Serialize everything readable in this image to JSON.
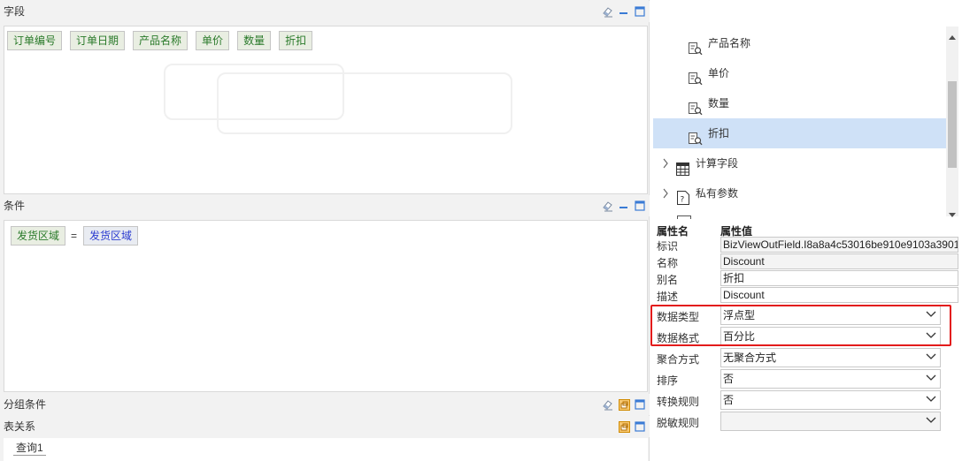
{
  "fields_panel": {
    "title": "字段",
    "chips": [
      "订单编号",
      "订单日期",
      "产品名称",
      "单价",
      "数量",
      "折扣"
    ]
  },
  "conditions_panel": {
    "title": "条件",
    "left": "发货区域",
    "operator": "=",
    "right": "发货区域"
  },
  "group_panel": {
    "title": "分组条件"
  },
  "relation_panel": {
    "title": "表关系",
    "tab": "查询1"
  },
  "tree": {
    "items": [
      {
        "label": "产品名称",
        "icon": "field-icon"
      },
      {
        "label": "单价",
        "icon": "field-icon"
      },
      {
        "label": "数量",
        "icon": "field-icon"
      },
      {
        "label": "折扣",
        "icon": "field-icon",
        "selected": true
      },
      {
        "label": "计算字段",
        "icon": "calculator-icon"
      },
      {
        "label": "私有参数",
        "icon": "parameter-icon"
      }
    ]
  },
  "properties": {
    "header_name": "属性名",
    "header_value": "属性值",
    "rows": [
      {
        "name": "标识",
        "value": "BizViewOutField.I8a8a4c53016be910e9103a3901"
      },
      {
        "name": "名称",
        "value": "Discount"
      },
      {
        "name": "别名",
        "value": "折扣"
      },
      {
        "name": "描述",
        "value": "Discount"
      },
      {
        "name": "数据类型",
        "value": "浮点型"
      },
      {
        "name": "数据格式",
        "value": "百分比"
      },
      {
        "name": "聚合方式",
        "value": "无聚合方式"
      },
      {
        "name": "排序",
        "value": "否"
      },
      {
        "name": "转换规则",
        "value": "否"
      },
      {
        "name": "脱敏规则",
        "value": ""
      }
    ]
  },
  "colors": {
    "highlight": "#e31b1b",
    "selected_row": "#cfe1f7",
    "chip_green": "#2a7a2a",
    "chip_blue": "#2b3bd0"
  }
}
